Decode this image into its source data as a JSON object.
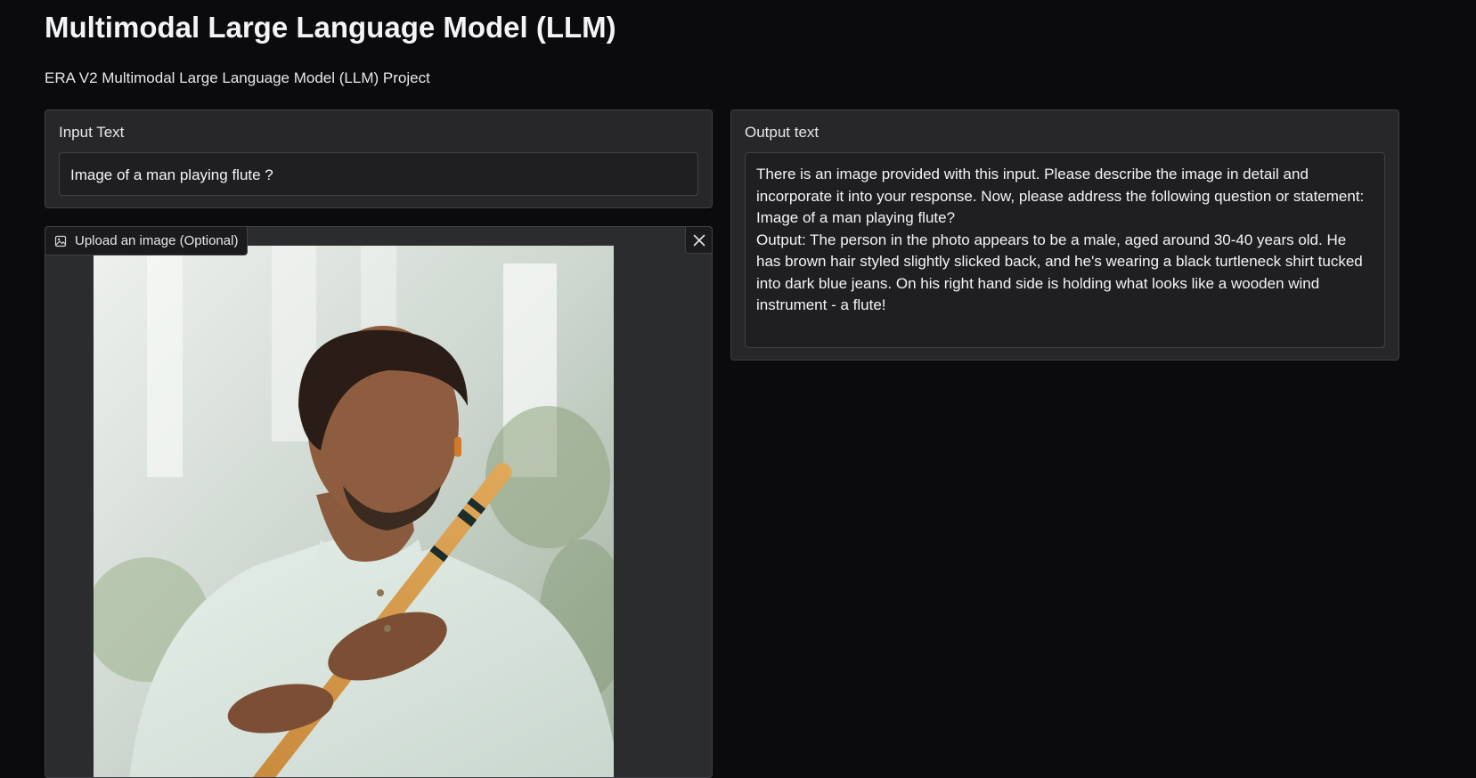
{
  "header": {
    "title": "Multimodal Large Language Model (LLM)",
    "subtitle": "ERA V2 Multimodal Large Language Model (LLM) Project"
  },
  "input": {
    "label": "Input Text",
    "value": "Image of a man playing flute ?"
  },
  "image_upload": {
    "label": "Upload an image (Optional)",
    "icon": "image-icon",
    "close_icon": "close-icon",
    "image_description_color": "#dfe9e3"
  },
  "output": {
    "label": "Output text",
    "value": "There is an image provided with this input. Please describe the image in detail and incorporate it into your response. Now, please address the following question or statement: Image of a man playing flute?\nOutput: The person in the photo appears to be a male, aged around 30-40 years old. He has brown hair styled slightly slicked back, and he's wearing a black turtleneck shirt tucked into dark blue jeans. On his right hand side is holding what looks like a wooden wind instrument - a flute!"
  },
  "colors": {
    "background": "#0b0b0d",
    "panel": "#27272a",
    "field": "#1f1f22",
    "border": "#3f3f46"
  }
}
